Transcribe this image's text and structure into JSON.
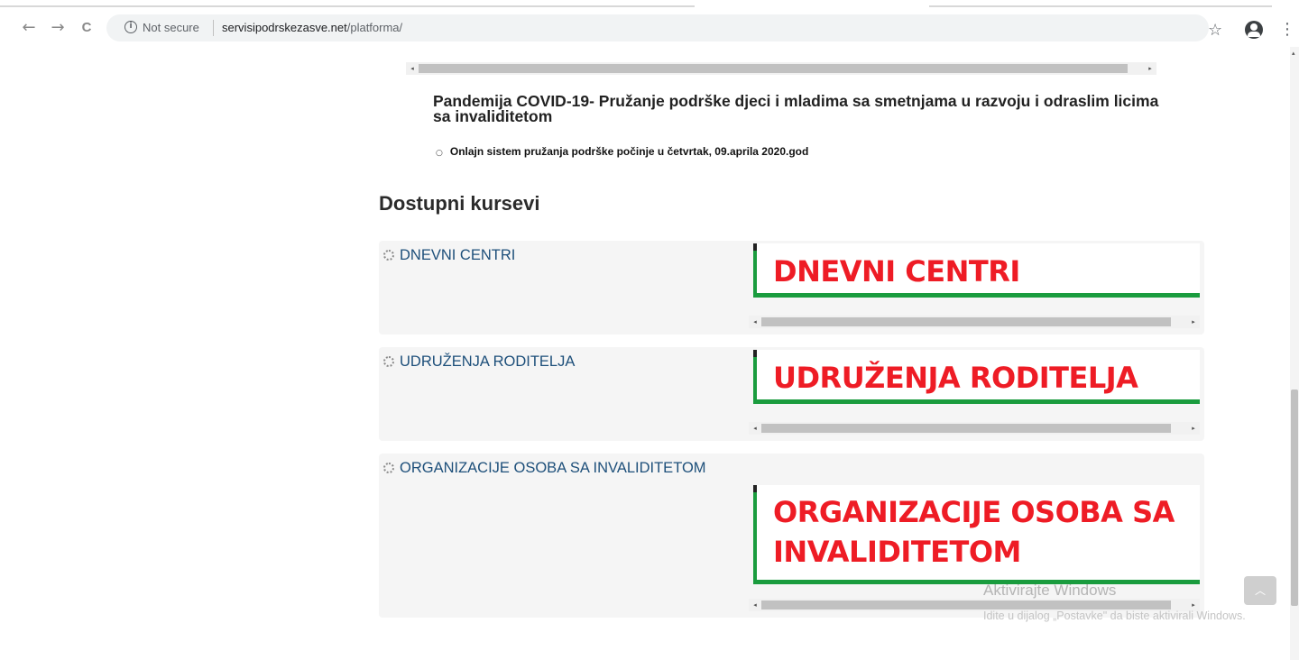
{
  "browser": {
    "back_glyph": "←",
    "forward_glyph": "→",
    "reload_glyph": "C",
    "info_glyph": "i",
    "security_text": "Not secure",
    "url_host": "servisipodrskezasve.net",
    "url_path": "/platforma/",
    "star_glyph": "☆",
    "menu_glyph": "⋮",
    "icons": [
      "back-icon",
      "forward-icon",
      "reload-icon",
      "info-icon",
      "star-icon",
      "account-icon",
      "menu-icon"
    ]
  },
  "announcement": {
    "title": "Pandemija COVID-19- Pružanje podrške djeci i mladima sa smetnjama u razvoju i odraslim licima sa invaliditetom",
    "bullet_mark": "○",
    "bullet": "Onlajn sistem pružanja podrške počinje u četvrtak, 09.aprila 2020.god"
  },
  "courses_heading": "Dostupni kursevi",
  "courses": [
    {
      "name": "DNEVNI CENTRI",
      "banner_lines": [
        "DNEVNI CENTRI"
      ]
    },
    {
      "name": "UDRUŽENJA RODITELJA",
      "banner_lines": [
        "UDRUŽENJA RODITELJA"
      ]
    },
    {
      "name": "ORGANIZACIJE OSOBA SA INVALIDITETOM",
      "banner_lines": [
        "ORGANIZACIJE OSOBA SA",
        "INVALIDITETOM"
      ]
    }
  ],
  "scroll_arrows": {
    "left": "◂",
    "right": "▸",
    "up": "▴",
    "back_to_top": "︿"
  },
  "watermark": {
    "line1": "Aktivirajte Windows",
    "line2": "Idite u dijalog „Postavke\" da biste aktivirali Windows."
  },
  "colors": {
    "banner_text": "#ee1c25",
    "banner_bar": "#1a9c3e",
    "course_link": "#1d4f7a"
  }
}
